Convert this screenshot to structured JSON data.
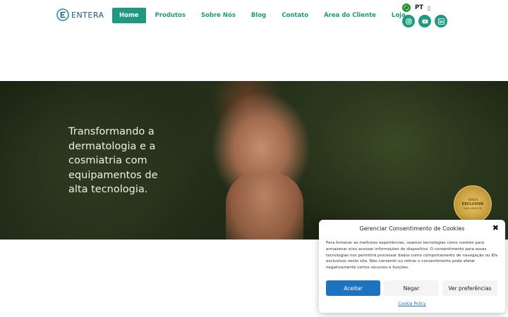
{
  "brand": {
    "name": "ENTERA",
    "color": "#1e9a80",
    "logo_color": "#1a5a8a"
  },
  "nav": {
    "items": [
      {
        "label": "Home",
        "active": true
      },
      {
        "label": "Produtos"
      },
      {
        "label": "Sobre Nós"
      },
      {
        "label": "Blog"
      },
      {
        "label": "Contato"
      },
      {
        "label": "Área do Cliente"
      },
      {
        "label": "Loja"
      }
    ]
  },
  "lang": {
    "code": "PT",
    "flag_icon": "brazil-flag-icon",
    "caret": "▯"
  },
  "socials": [
    {
      "icon": "instagram-icon"
    },
    {
      "icon": "youtube-icon"
    },
    {
      "icon": "linkedin-icon"
    }
  ],
  "hero": {
    "headline": "Transformando a dermatologia e a cosmiatria com equipamentos de alta tecnologia.",
    "badge": {
      "line1": "VENDA",
      "line2": "EXCLUSIVA",
      "line3": "PARA MÉDICOS"
    }
  },
  "cookie": {
    "title": "Gerenciar Consentimento de Cookies",
    "close": "✖",
    "body": "Para fornecer as melhores experiências, usamos tecnologias como cookies para armazenar e/ou acessar informações do dispositivo. O consentimento para essas tecnologias nos permitirá processar dados como comportamento de navegação ou IDs exclusivos neste site. Não consentir ou retirar o consentimento pode afetar negativamente certos recursos e funções.",
    "accept": "Aceitar",
    "deny": "Negar",
    "preferences": "Ver preferências",
    "policy": "Cookie Policy",
    "accent": "#1e73be"
  }
}
